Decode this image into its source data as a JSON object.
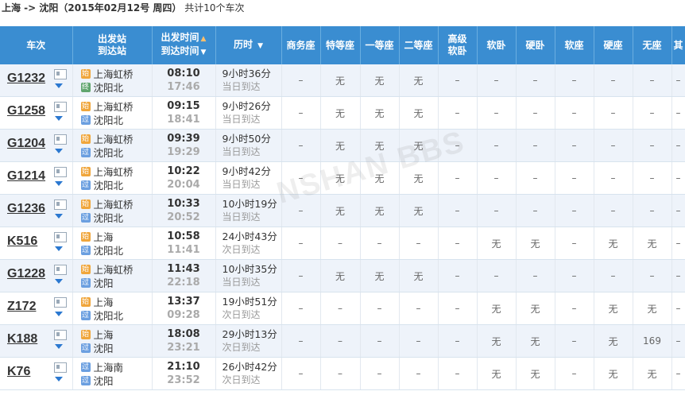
{
  "route": {
    "text_route": "上海 -> 沈阳",
    "text_date": "（2015年02月12号 周四）",
    "text_count": "共计10个车次"
  },
  "headers": {
    "train": "车次",
    "station_dep": "出发站",
    "station_arr": "到达站",
    "time_dep": "出发时间",
    "time_arr": "到达时间",
    "duration": "历时",
    "seats": [
      "商务座",
      "特等座",
      "一等座",
      "二等座",
      "高级",
      "软卧",
      "硬卧",
      "软座",
      "硬座",
      "无座",
      "其"
    ],
    "seat_senior_line2": "软卧"
  },
  "badges": {
    "start": "始",
    "pass": "过",
    "end": "终"
  },
  "trains": [
    {
      "no": "G1232",
      "from": "上海虹桥",
      "from_type": "start",
      "to": "沈阳北",
      "to_type": "end",
      "dep": "08:10",
      "arr": "17:46",
      "dur": "9小时36分",
      "day": "当日到达",
      "seats": [
        "–",
        "无",
        "无",
        "无",
        "–",
        "–",
        "–",
        "–",
        "–",
        "–",
        "–"
      ]
    },
    {
      "no": "G1258",
      "from": "上海虹桥",
      "from_type": "start",
      "to": "沈阳北",
      "to_type": "pass",
      "dep": "09:15",
      "arr": "18:41",
      "dur": "9小时26分",
      "day": "当日到达",
      "seats": [
        "–",
        "无",
        "无",
        "无",
        "–",
        "–",
        "–",
        "–",
        "–",
        "–",
        "–"
      ]
    },
    {
      "no": "G1204",
      "from": "上海虹桥",
      "from_type": "start",
      "to": "沈阳北",
      "to_type": "pass",
      "dep": "09:39",
      "arr": "19:29",
      "dur": "9小时50分",
      "day": "当日到达",
      "seats": [
        "–",
        "无",
        "无",
        "无",
        "–",
        "–",
        "–",
        "–",
        "–",
        "–",
        "–"
      ]
    },
    {
      "no": "G1214",
      "from": "上海虹桥",
      "from_type": "start",
      "to": "沈阳北",
      "to_type": "pass",
      "dep": "10:22",
      "arr": "20:04",
      "dur": "9小时42分",
      "day": "当日到达",
      "seats": [
        "–",
        "无",
        "无",
        "无",
        "–",
        "–",
        "–",
        "–",
        "–",
        "–",
        "–"
      ]
    },
    {
      "no": "G1236",
      "from": "上海虹桥",
      "from_type": "start",
      "to": "沈阳北",
      "to_type": "pass",
      "dep": "10:33",
      "arr": "20:52",
      "dur": "10小时19分",
      "day": "当日到达",
      "seats": [
        "–",
        "无",
        "无",
        "无",
        "–",
        "–",
        "–",
        "–",
        "–",
        "–",
        "–"
      ]
    },
    {
      "no": "K516",
      "from": "上海",
      "from_type": "start",
      "to": "沈阳北",
      "to_type": "pass",
      "dep": "10:58",
      "arr": "11:41",
      "dur": "24小时43分",
      "day": "次日到达",
      "seats": [
        "–",
        "–",
        "–",
        "–",
        "–",
        "无",
        "无",
        "–",
        "无",
        "无",
        "–"
      ]
    },
    {
      "no": "G1228",
      "from": "上海虹桥",
      "from_type": "start",
      "to": "沈阳",
      "to_type": "pass",
      "dep": "11:43",
      "arr": "22:18",
      "dur": "10小时35分",
      "day": "当日到达",
      "seats": [
        "–",
        "无",
        "无",
        "无",
        "–",
        "–",
        "–",
        "–",
        "–",
        "–",
        "–"
      ]
    },
    {
      "no": "Z172",
      "from": "上海",
      "from_type": "start",
      "to": "沈阳北",
      "to_type": "pass",
      "dep": "13:37",
      "arr": "09:28",
      "dur": "19小时51分",
      "day": "次日到达",
      "seats": [
        "–",
        "–",
        "–",
        "–",
        "–",
        "无",
        "无",
        "–",
        "无",
        "无",
        "–"
      ]
    },
    {
      "no": "K188",
      "from": "上海",
      "from_type": "start",
      "to": "沈阳",
      "to_type": "pass",
      "dep": "18:08",
      "arr": "23:21",
      "dur": "29小时13分",
      "day": "次日到达",
      "seats": [
        "–",
        "–",
        "–",
        "–",
        "–",
        "无",
        "无",
        "–",
        "无",
        "169",
        "–"
      ]
    },
    {
      "no": "K76",
      "from": "上海南",
      "from_type": "pass",
      "to": "沈阳",
      "to_type": "pass",
      "dep": "21:10",
      "arr": "23:52",
      "dur": "26小时42分",
      "day": "次日到达",
      "seats": [
        "–",
        "–",
        "–",
        "–",
        "–",
        "无",
        "无",
        "–",
        "无",
        "无",
        "–"
      ]
    }
  ],
  "watermark": "NSHAN BBS"
}
